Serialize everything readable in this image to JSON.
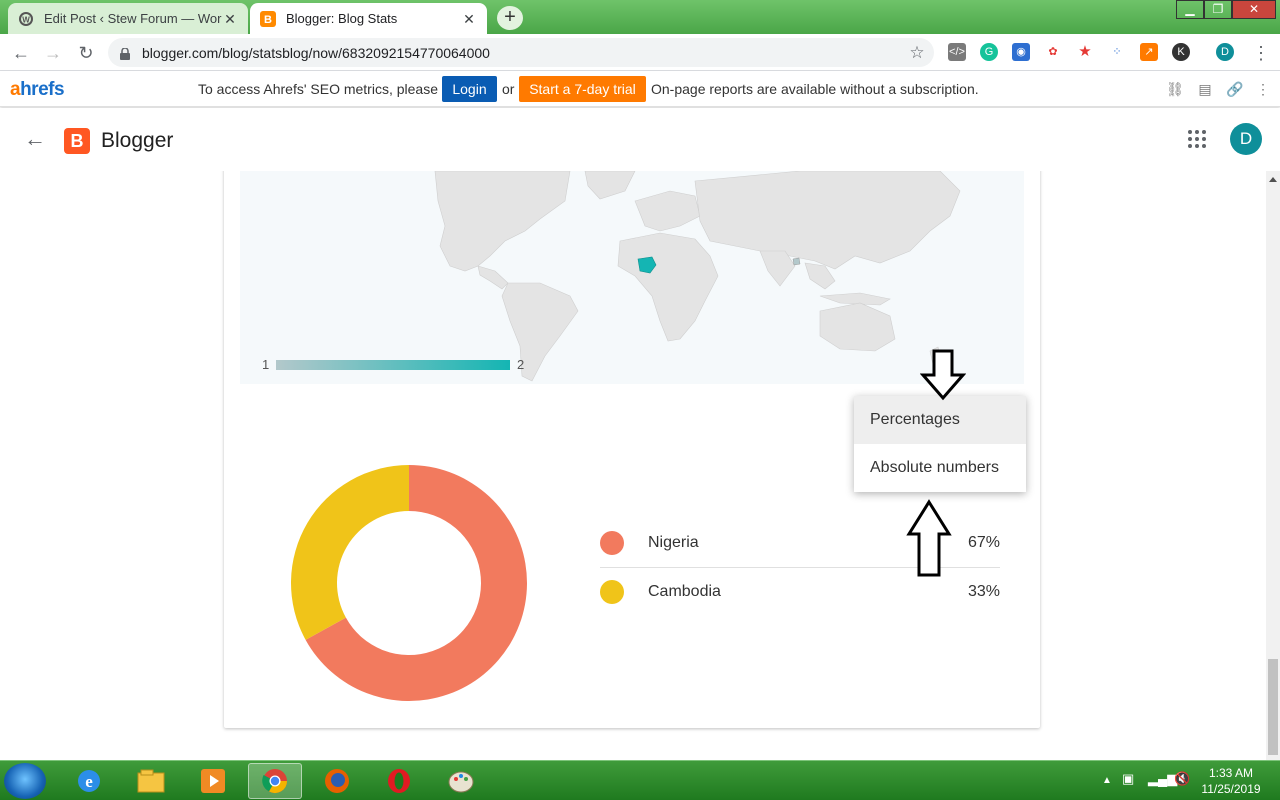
{
  "browser": {
    "tabs": [
      {
        "label": "Edit Post ‹ Stew Forum — WordP",
        "icon": "wordpress-icon",
        "active": false
      },
      {
        "label": "Blogger: Blog Stats",
        "icon": "blogger-icon",
        "active": true
      }
    ],
    "url": "blogger.com/blog/statsblog/now/6832092154770064000",
    "profile_initial": "D"
  },
  "ahrefs": {
    "logo_a": "a",
    "logo_rest": "hrefs",
    "message": "To access Ahrefs' SEO metrics, please",
    "login_label": "Login",
    "or_label": "or",
    "trial_label": "Start a 7-day trial",
    "message2": "On-page reports are available without a subscription."
  },
  "blogger": {
    "title": "Blogger",
    "logo_letter": "B",
    "avatar_initial": "D"
  },
  "map": {
    "scale_min": "1",
    "scale_max": "2",
    "highlight_color": "#14b5b3"
  },
  "menu": {
    "items": [
      "Percentages",
      "Absolute numbers"
    ]
  },
  "chart_data": {
    "type": "pie",
    "categories": [
      "Nigeria",
      "Cambodia"
    ],
    "values": [
      67,
      33
    ],
    "labels": [
      "67%",
      "33%"
    ],
    "colors": [
      "#f27a5e",
      "#f0c419"
    ]
  },
  "taskbar": {
    "time": "1:33 AM",
    "date": "11/25/2019"
  }
}
